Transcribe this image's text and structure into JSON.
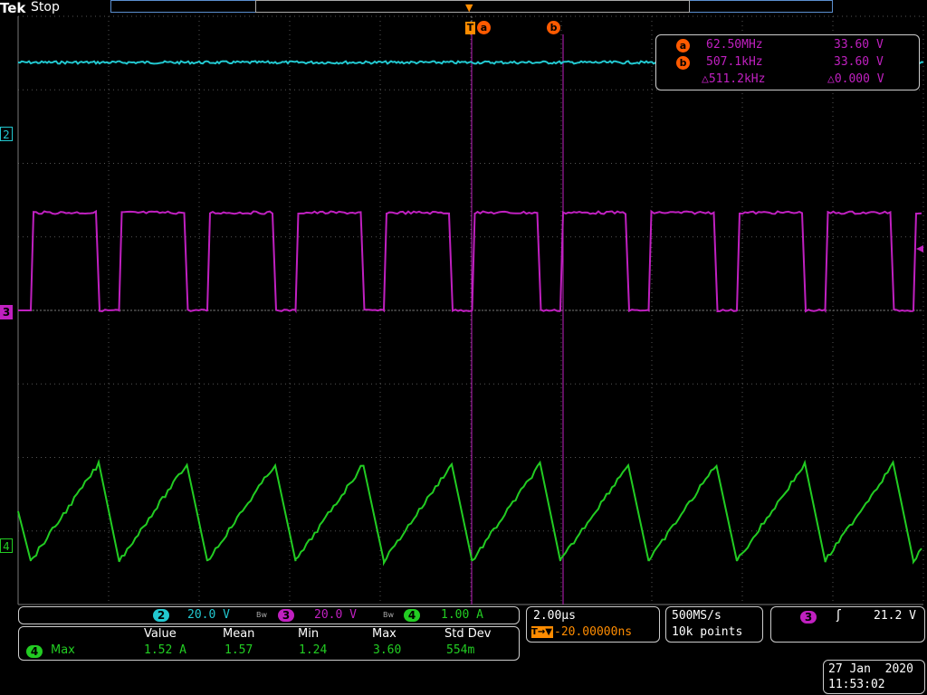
{
  "header": {
    "brand": "Tek",
    "status": "Stop"
  },
  "colors": {
    "ch2": "#22c8d0",
    "ch3": "#c020c0",
    "ch4": "#22cc22",
    "cursor": "#ff6a00",
    "trigger": "#ff8c00",
    "grid": "#5a5a5a"
  },
  "channel_markers": {
    "ch2": "2",
    "ch3": "3",
    "ch4": "4"
  },
  "cursors": {
    "a_label": "a",
    "b_label": "b",
    "trigger_label": "T",
    "a_freq": "62.50MHz",
    "a_volt": "33.60 V",
    "b_freq": "507.1kHz",
    "b_volt": "33.60 V",
    "delta_freq": "△511.2kHz",
    "delta_volt": "△0.000 V"
  },
  "vertical": {
    "ch2": {
      "num": "2",
      "scale": "20.0 V"
    },
    "ch3": {
      "num": "3",
      "scale": "20.0 V"
    },
    "ch4": {
      "num": "4",
      "scale": "1.00 A"
    },
    "bw": "Bw"
  },
  "measurements": {
    "headers": [
      "Value",
      "Mean",
      "Min",
      "Max",
      "Std Dev"
    ],
    "row": {
      "ch": "4",
      "name": "Max",
      "values": [
        "1.52 A",
        "1.57",
        "1.24",
        "3.60",
        "554m"
      ]
    }
  },
  "timebase": {
    "scale": "2.00µs",
    "delay": "-20.00000ns"
  },
  "acquisition": {
    "rate": "500MS/s",
    "points": "10k points"
  },
  "trigger": {
    "ch": "3",
    "slope": "ʃ",
    "level": "21.2 V"
  },
  "datetime": {
    "date": "27 Jan  2020",
    "time": "11:53:02"
  }
}
